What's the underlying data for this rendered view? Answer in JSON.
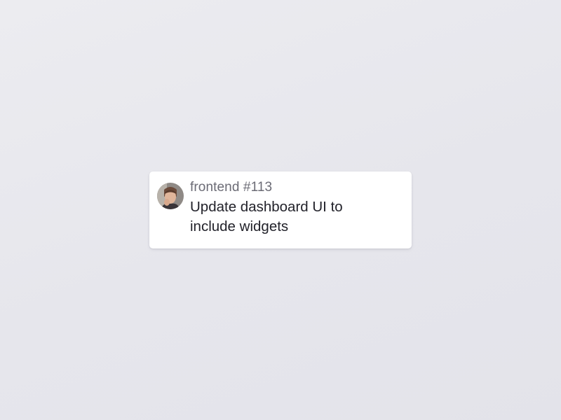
{
  "card": {
    "repo_label": "frontend #113",
    "title": "Update dashboard UI to include widgets",
    "avatar": "user-avatar-photo"
  },
  "colors": {
    "background": "#e8e8ee",
    "card": "#ffffff",
    "repo_text": "#6b6b75",
    "title_text": "#22222a"
  }
}
